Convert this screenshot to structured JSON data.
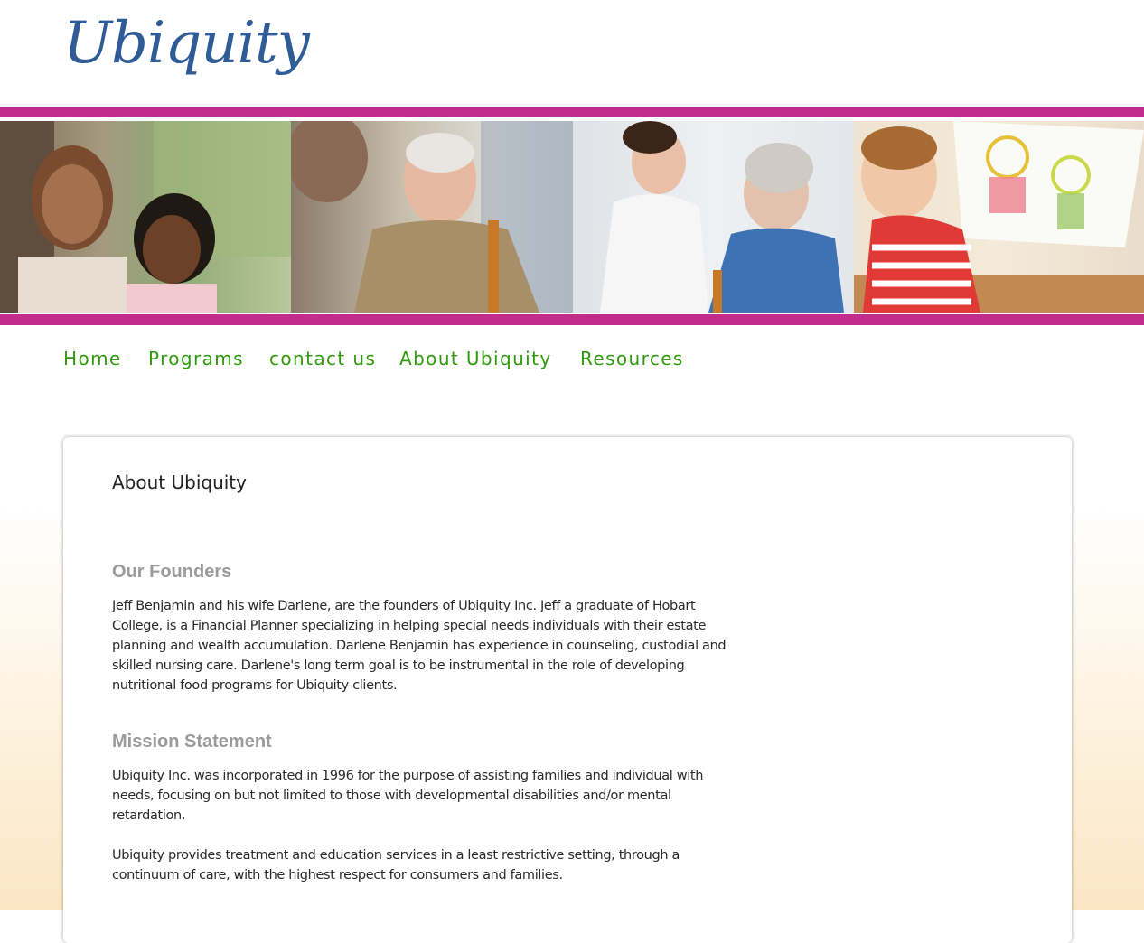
{
  "logo": {
    "text": "Ubiquity"
  },
  "banner": {
    "photos": [
      "mother-and-daughter-photo",
      "elderly-man-with-cane-photo",
      "nurse-with-elderly-woman-photo",
      "boy-with-drawing-photo"
    ]
  },
  "nav": {
    "items": [
      "Home",
      "Programs",
      "contact us",
      "About Ubiquity",
      "Resources"
    ]
  },
  "content": {
    "title": "About Ubiquity",
    "founders": {
      "heading": "Our Founders",
      "text": "Jeff Benjamin and his wife Darlene, are the founders of Ubiquity Inc. Jeff a graduate of Hobart College, is a Financial Planner specializing in helping special needs individuals with their estate planning and wealth accumulation. Darlene Benjamin has experience in counseling, custodial and skilled nursing care. Darlene's long term goal is to be instrumental in the role of developing nutritional food programs for Ubiquity clients."
    },
    "mission": {
      "heading": "Mission Statement",
      "text1": "Ubiquity Inc. was incorporated in 1996 for the purpose of assisting families and individual with needs, focusing on but not limited to those with developmental disabilities and/or mental retardation.",
      "text2": "Ubiquity provides treatment and education services in a least restrictive setting, through a continuum of care, with the highest respect for consumers and families."
    }
  },
  "colors": {
    "brand_blue": "#2f5c96",
    "band_magenta": "#c22d8b",
    "nav_green": "#2f9a0e",
    "heading_gray": "#9b9b9b"
  }
}
